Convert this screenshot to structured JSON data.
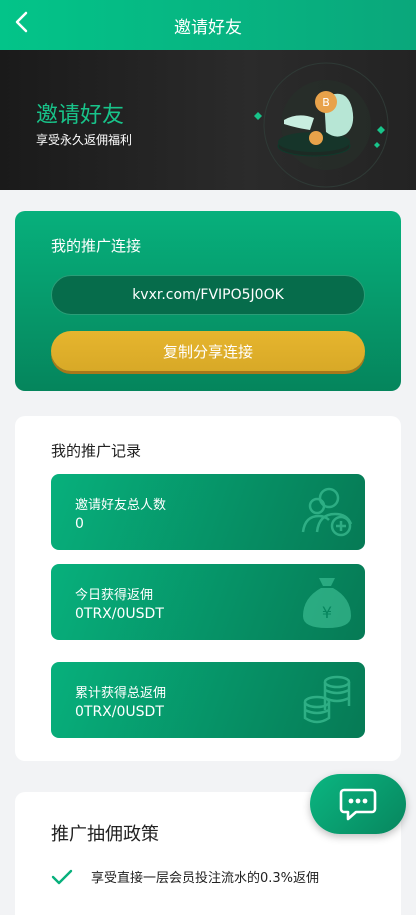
{
  "header": {
    "title": "邀请好友",
    "back_icon": "chevron-left-icon"
  },
  "banner": {
    "title": "邀请好友",
    "subtitle": "享受永久返佣福利"
  },
  "promo_link": {
    "title": "我的推广连接",
    "link": "kvxr.com/FVIPO5J0OK",
    "copy_label": "复制分享连接"
  },
  "records": {
    "title": "我的推广记录",
    "items": [
      {
        "label": "邀请好友总人数",
        "value": "0",
        "icon": "add-user-icon"
      },
      {
        "label": "今日获得返佣",
        "value": "0TRX/0USDT",
        "icon": "money-bag-icon"
      },
      {
        "label": "累计获得总返佣",
        "value": "0TRX/0USDT",
        "icon": "coin-stack-icon"
      }
    ]
  },
  "policy": {
    "title": "推广抽佣政策",
    "items": [
      {
        "text": "享受直接一层会员投注流水的0.3%返佣"
      }
    ]
  },
  "chat": {
    "icon": "chat-bubble-icon"
  },
  "colors": {
    "primary": "#07b07c",
    "gold": "#e0b02a",
    "dark": "#222222"
  }
}
